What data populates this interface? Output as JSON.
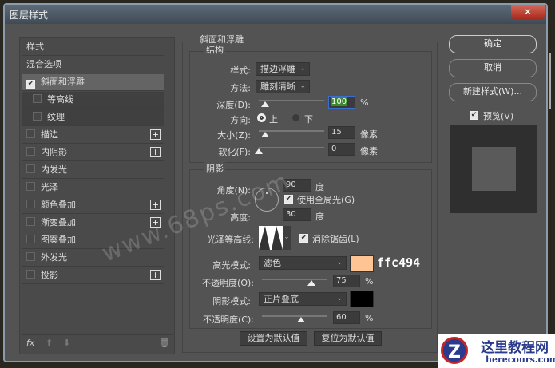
{
  "window": {
    "title": "图层样式",
    "close": "×"
  },
  "sidebar": {
    "items": [
      {
        "label": "样式",
        "type": "header"
      },
      {
        "label": "混合选项",
        "type": "header"
      },
      {
        "label": "斜面和浮雕",
        "checked": true,
        "selected": true
      },
      {
        "label": "等高线",
        "checked": false,
        "sub": true
      },
      {
        "label": "纹理",
        "checked": false,
        "sub": true
      },
      {
        "label": "描边",
        "checked": false,
        "plus": true
      },
      {
        "label": "内阴影",
        "checked": false,
        "plus": true
      },
      {
        "label": "内发光",
        "checked": false
      },
      {
        "label": "光泽",
        "checked": false
      },
      {
        "label": "颜色叠加",
        "checked": false,
        "plus": true
      },
      {
        "label": "渐变叠加",
        "checked": false,
        "plus": true
      },
      {
        "label": "图案叠加",
        "checked": false
      },
      {
        "label": "外发光",
        "checked": false
      },
      {
        "label": "投影",
        "checked": false,
        "plus": true
      }
    ],
    "footer": {
      "fx": "fx"
    }
  },
  "bevel": {
    "title": "斜面和浮雕",
    "structure": {
      "title": "结构",
      "style_label": "样式:",
      "style_value": "描边浮雕",
      "technique_label": "方法:",
      "technique_value": "雕刻清晰",
      "depth_label": "深度(D):",
      "depth_value": "100",
      "depth_unit": "%",
      "depth_pct": 0.1,
      "direction_label": "方向:",
      "dir_up": "上",
      "dir_down": "下",
      "size_label": "大小(Z):",
      "size_value": "15",
      "size_unit": "像素",
      "size_pct": 0.1,
      "soften_label": "软化(F):",
      "soften_value": "0",
      "soften_unit": "像素",
      "soften_pct": 0
    },
    "shading": {
      "title": "阴影",
      "angle_label": "角度(N):",
      "angle_value": "90",
      "angle_unit": "度",
      "global_light": "使用全局光(G)",
      "altitude_label": "高度:",
      "altitude_value": "30",
      "altitude_unit": "度",
      "gloss_label": "光泽等高线:",
      "antialias": "消除锯齿(L)",
      "highlight_label": "高光模式:",
      "highlight_mode": "滤色",
      "highlight_color": "#ffc494",
      "highlight_hex": "ffc494",
      "hl_opacity_label": "不透明度(O):",
      "hl_opacity": "75",
      "hl_unit": "%",
      "hl_pct": 0.75,
      "shadow_label": "阴影模式:",
      "shadow_mode": "正片叠底",
      "shadow_color": "#000000",
      "sh_opacity_label": "不透明度(C):",
      "sh_opacity": "60",
      "sh_unit": "%",
      "sh_pct": 0.6
    },
    "make_default": "设置为默认值",
    "reset_default": "复位为默认值"
  },
  "right": {
    "ok": "确定",
    "cancel": "取消",
    "new_style": "新建样式(W)...",
    "preview": "预览(V)"
  },
  "watermark": "www.68ps.com",
  "logo": {
    "cn": "这里教程网",
    "en": "herecours.com"
  }
}
